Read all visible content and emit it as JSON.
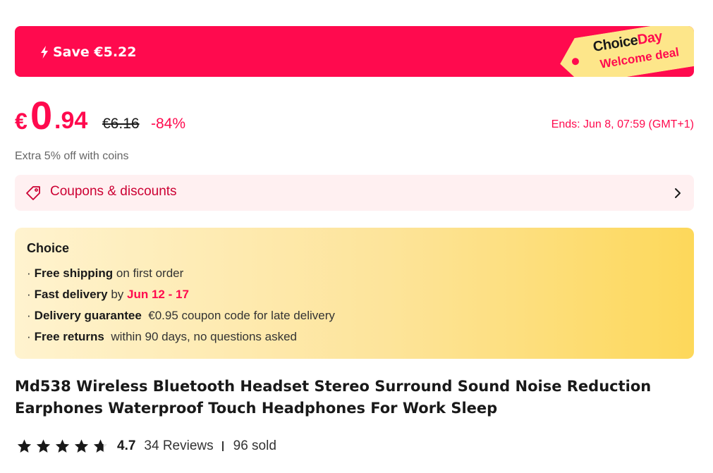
{
  "banner": {
    "save_text": "Save €5.22",
    "tag_choice": "Choice",
    "tag_day": "Day",
    "tag_welcome": "Welcome deal",
    "colors": {
      "background": "#ff0a4e",
      "tag": "#fde68a"
    },
    "icon": "lightning-bolt-icon"
  },
  "price": {
    "currency": "€",
    "integer": "0",
    "decimal": ".94",
    "original": "€6.16",
    "discount": "-84%",
    "ends": "Ends: Jun 8, 07:59 (GMT+1)"
  },
  "coins_text": "Extra 5% off with coins",
  "coupons": {
    "label": "Coupons & discounts",
    "icon": "coupon-tag-icon",
    "chevron": "chevron-right-icon"
  },
  "choice": {
    "title": "Choice",
    "items": [
      {
        "bullet": "·",
        "bold": "Free shipping",
        "text": " on first order"
      },
      {
        "bullet": "·",
        "bold": "Fast delivery",
        "text": " by ",
        "highlight": "Jun 12 - 17"
      },
      {
        "bullet": "·",
        "bold": "Delivery guarantee",
        "text": "  €0.95 coupon code for late delivery"
      },
      {
        "bullet": "·",
        "bold": "Free returns",
        "text": "  within 90 days, no questions asked"
      }
    ]
  },
  "product": {
    "title": "Md538 Wireless Bluetooth Headset Stereo Surround Sound Noise Reduction Earphones Waterproof Touch Headphones For Work Sleep"
  },
  "rating": {
    "score": "4.7",
    "stars": 4.7,
    "reviews": "34 Reviews",
    "sold": "96 sold"
  },
  "accent_color": "#ff0a4e"
}
